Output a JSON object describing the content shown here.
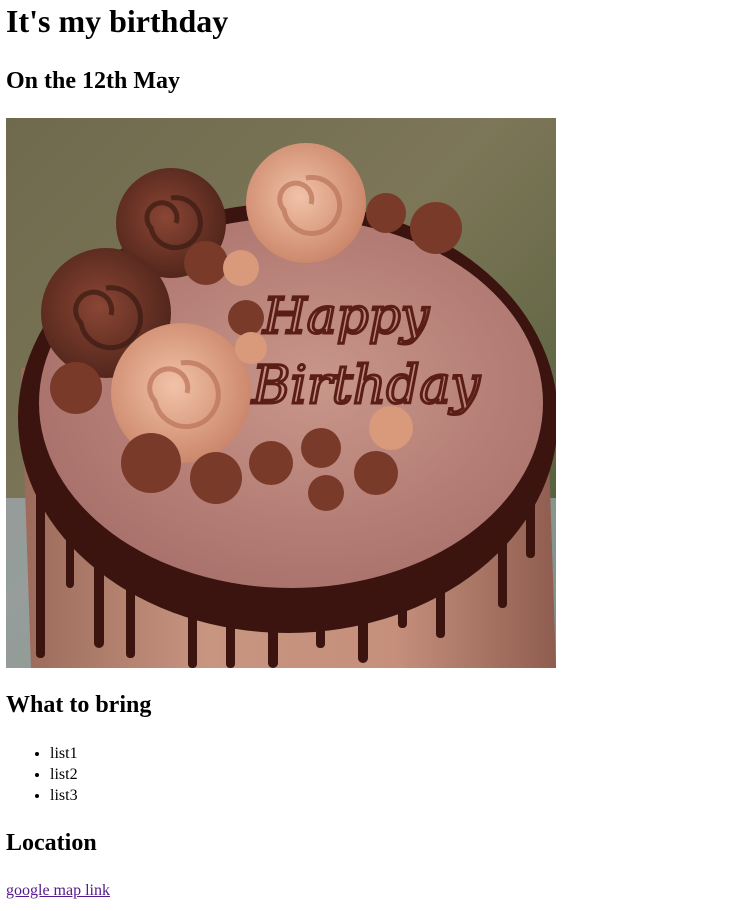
{
  "heading": "It's my birthday",
  "date": "On the 12th May",
  "cake_image": {
    "icon": "birthday-cake-photo",
    "inscription_line1": "Happy",
    "inscription_line2": "Birthday"
  },
  "bring": {
    "title": "What to bring",
    "items": [
      "list1",
      "list2",
      "list3"
    ]
  },
  "location": {
    "title": "Location",
    "link_text": "google map link"
  },
  "colors": {
    "text": "#000000",
    "visited_link": "#551a8b",
    "background": "#ffffff"
  }
}
